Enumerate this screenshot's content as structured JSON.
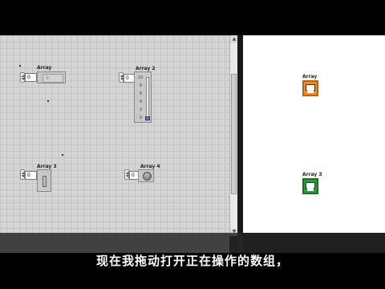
{
  "front_panel": {
    "controls": [
      {
        "label": "Array",
        "index": "0",
        "element_value": "0"
      },
      {
        "label": "Array 2",
        "index": "0",
        "slider": {
          "ticks": [
            "10",
            "8",
            "6",
            "4",
            "2",
            "0"
          ],
          "value": 0
        }
      },
      {
        "label": "Array 3",
        "index": "0"
      },
      {
        "label": "Array 4",
        "index": "0"
      }
    ]
  },
  "block_diagram": {
    "terminals": [
      {
        "label": "Array",
        "color": "#f28c28"
      },
      {
        "label": "Array 3",
        "color": "#2e9a3e"
      }
    ]
  },
  "subtitle": "现在我拖动打开正在操作的数组，"
}
